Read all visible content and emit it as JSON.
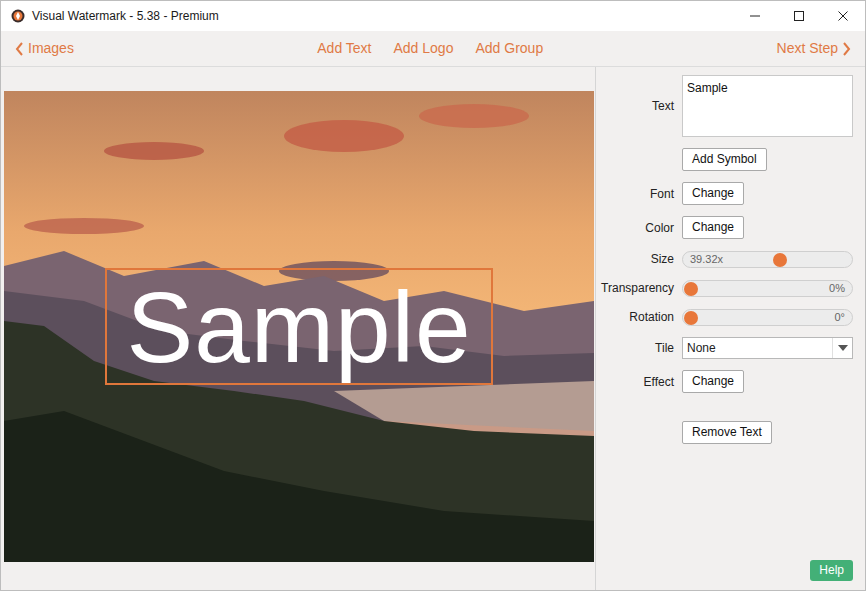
{
  "window": {
    "title": "Visual Watermark - 5.38 - Premium"
  },
  "toolbar": {
    "back": "Images",
    "actions": [
      "Add Text",
      "Add Logo",
      "Add Group"
    ],
    "next": "Next Step"
  },
  "canvas": {
    "overlay_text": "Sample",
    "selected": true
  },
  "panel": {
    "text": {
      "label": "Text",
      "value": "Sample"
    },
    "add_symbol": "Add Symbol",
    "rows": [
      {
        "kind": "button",
        "label": "Font",
        "button": "Change"
      },
      {
        "kind": "button",
        "label": "Color",
        "button": "Change"
      },
      {
        "kind": "scale",
        "label": "Size",
        "reading": "39.32x",
        "level": 0.58
      },
      {
        "kind": "slider",
        "label": "Transparency",
        "reading": "0%",
        "level": 0
      },
      {
        "kind": "slider",
        "label": "Rotation",
        "reading": "0°",
        "level": 0
      },
      {
        "kind": "select",
        "label": "Tile",
        "value": "None"
      },
      {
        "kind": "button",
        "label": "Effect",
        "button": "Change"
      }
    ],
    "remove_button": "Remove Text"
  },
  "help_button": "Help"
}
